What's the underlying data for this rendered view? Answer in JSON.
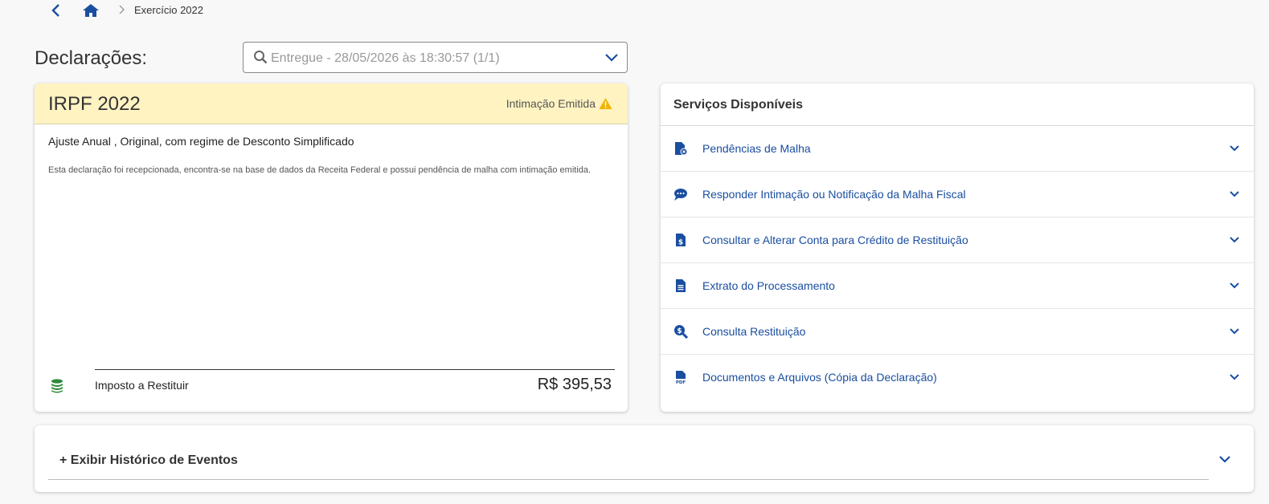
{
  "breadcrumb": {
    "back_icon": "chevron-left-icon",
    "home_icon": "home-icon",
    "separator_icon": "chevron-right-icon",
    "current": "Exercício 2022"
  },
  "declarations": {
    "title": "Declarações:",
    "selected": "Entregue - 28/05/2026 às 18:30:57 (1/1)",
    "search_icon": "search-icon",
    "dropdown_icon": "chevron-down-icon"
  },
  "irpf": {
    "title": "IRPF 2022",
    "status": "Intimação Emitida",
    "status_icon": "warning-icon",
    "subtitle": "Ajuste Anual , Original, com regime de Desconto Simplificado",
    "description": "Esta declaração foi recepcionada, encontra-se na base de dados da Receita Federal e possui pendência de malha com intimação emitida.",
    "amount_icon": "coins-icon",
    "amount_label": "Imposto a Restituir",
    "amount_value": "R$ 395,53"
  },
  "services": {
    "title": "Serviços Disponíveis",
    "items": [
      {
        "label": "Pendências de Malha",
        "icon": "file-alert-icon"
      },
      {
        "label": "Responder Intimação ou Notificação da Malha Fiscal",
        "icon": "chat-icon"
      },
      {
        "label": "Consultar e Alterar Conta para Crédito de Restituição",
        "icon": "file-dollar-icon"
      },
      {
        "label": "Extrato do Processamento",
        "icon": "file-text-icon"
      },
      {
        "label": "Consulta Restituição",
        "icon": "search-dollar-icon"
      },
      {
        "label": "Documentos e Arquivos (Cópia da Declaração)",
        "icon": "pdf-icon"
      }
    ]
  },
  "history": {
    "label": "+ Exibir Histórico de Eventos"
  },
  "colors": {
    "accent": "#1a4ea0",
    "warning_bg": "#fff3c2",
    "warning_icon": "#f0b400",
    "coins": "#2e8b3a"
  }
}
